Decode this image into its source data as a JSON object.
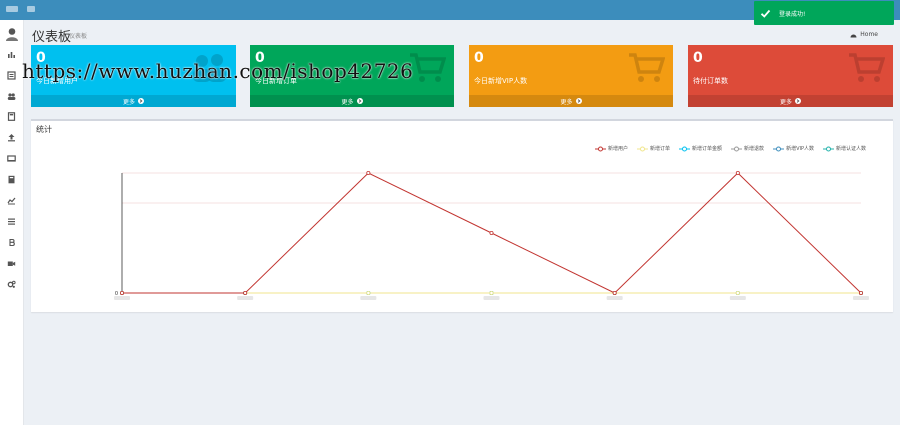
{
  "header": {
    "title": "仪表板",
    "subtitle": "仪表板",
    "breadcrumb": "Home"
  },
  "sidebar": {
    "icons": [
      "user-avatar",
      "bar-chart-icon",
      "list-icon",
      "users-icon",
      "calculator-icon",
      "upload-icon",
      "video-icon",
      "book-icon",
      "line-chart-icon",
      "menu-icon",
      "bitcoin-icon",
      "camera-icon",
      "cogs-icon"
    ]
  },
  "stats": [
    {
      "value": "0",
      "label": "今日新增用户",
      "more": "更多",
      "color": "#00c0ef",
      "icon": "users-icon"
    },
    {
      "value": "0",
      "label": "今日新增订单",
      "more": "更多",
      "color": "#00a65a",
      "icon": "cart-icon"
    },
    {
      "value": "0",
      "label": "今日新增VIP人数",
      "more": "更多",
      "color": "#f39c12",
      "icon": "cart-icon"
    },
    {
      "value": "0",
      "label": "待付订单数",
      "more": "更多",
      "color": "#dd4b39",
      "icon": "cart-icon"
    }
  ],
  "panel": {
    "title": "统计"
  },
  "chart_data": {
    "type": "line",
    "categories": [
      "",
      "",
      "",
      "",
      "",
      "",
      ""
    ],
    "series": [
      {
        "name": "新增用户",
        "color": "#c23531",
        "values": [
          0,
          0,
          1,
          0.5,
          0,
          1,
          0
        ]
      },
      {
        "name": "新增订单",
        "color": "#f0e68c",
        "values": [
          0,
          0,
          0,
          0,
          0,
          0,
          0
        ]
      },
      {
        "name": "新增订单金额",
        "color": "#00c0ef",
        "values": [
          0,
          0,
          0,
          0,
          0,
          0,
          0
        ]
      },
      {
        "name": "新增退款",
        "color": "#999999",
        "values": [
          0,
          0,
          0,
          0,
          0,
          0,
          0
        ]
      },
      {
        "name": "新增VIP人数",
        "color": "#3c8dbc",
        "values": [
          0,
          0,
          0,
          0,
          0,
          0,
          0
        ]
      },
      {
        "name": "新增认证人数",
        "color": "#20b2aa",
        "values": [
          0,
          0,
          0,
          0,
          0,
          0,
          0
        ]
      }
    ],
    "yticks": [
      "0",
      "",
      ""
    ],
    "ylim": [
      0,
      1
    ],
    "grid": true
  },
  "toast": {
    "message": "登录成功!"
  },
  "watermark": "https://www.huzhan.com/ishop42726"
}
